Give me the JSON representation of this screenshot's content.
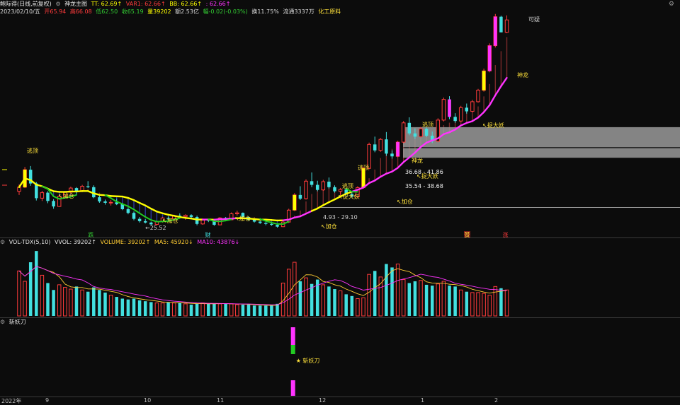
{
  "header": {
    "name": "鲍际得(日线,前复权)",
    "indicator": "神龙主图",
    "tt": "TT: 62.69↑",
    "var1": "VAR1: 62.66↑",
    "bb": "BB: 62.66↑",
    "extra": ": 62.66↑",
    "date": "2023/02/10/五",
    "open": "开65.94",
    "high": "高66.08",
    "low": "低62.50",
    "close": "收65.19",
    "volume": "量39202",
    "amount": "额2.53亿",
    "change": "幅-0.02(-0.03%)",
    "turnover": "换11.75%",
    "float": "流通3337万",
    "sector": "化工原料"
  },
  "vol_header": {
    "name": "VOL-TDX(5,10)",
    "vvol": "VVOL: 39202↑",
    "volume": "VOLUME: 39202↑",
    "ma5": "MA5: 45920↓",
    "ma10": "MA10: 43876↓"
  },
  "third_header": {
    "name": "斩妖刀"
  },
  "annotations": {
    "escape_top_1": "逃顶",
    "escape_top_2": "逃顶",
    "escape_top_3": "逃顶",
    "add_1": "↖加仓",
    "add_2": "↖加仓",
    "add_3": "↖加仓",
    "add_4": "↖加仓",
    "add_5": "↖加仓",
    "low_mark": "←25.52",
    "range_low": "4.93 - 29.10",
    "catch_1": "↖捉大妖",
    "catch_2": "↖捉大妖",
    "catch_3": "↖捉大妖",
    "dragon_1": "神龙",
    "dragon_2": "神龙",
    "band_top_range": "36.68 - 41.86",
    "band_low_range": "35.54 - 38.68",
    "top_mark": "可疑",
    "fall_tag": "跌",
    "fin_tag_1": "财",
    "fin_tag_2": "赞",
    "rise_tag": "涨",
    "blade": "★ 斩妖刀"
  },
  "x_axis": [
    "2022年",
    "9",
    "10",
    "11",
    "12",
    "1",
    "2"
  ],
  "colors": {
    "up": "#ff3b3b",
    "down": "#42e0e0",
    "yellow": "#ffff00",
    "magenta": "#ff33ff",
    "green": "#22cc22",
    "band": "#b0b0b0",
    "text_yellow": "#ffe23b"
  },
  "chart_data": {
    "type": "candlestick",
    "price_candles": [
      [
        27.9,
        29.4,
        27.1,
        28.8
      ],
      [
        28.8,
        33.2,
        28.6,
        32.6
      ],
      [
        32.6,
        33.4,
        29.1,
        29.6
      ],
      [
        29.6,
        29.9,
        25.9,
        26.4
      ],
      [
        26.4,
        28.0,
        25.8,
        27.6
      ],
      [
        27.6,
        27.9,
        25.3,
        25.8
      ],
      [
        25.8,
        26.2,
        24.1,
        24.6
      ],
      [
        24.6,
        27.1,
        24.5,
        26.8
      ],
      [
        26.8,
        28.0,
        26.5,
        27.7
      ],
      [
        27.7,
        28.9,
        27.4,
        28.6
      ],
      [
        28.6,
        28.8,
        27.4,
        27.9
      ],
      [
        27.9,
        29.3,
        27.7,
        29.0
      ],
      [
        29.0,
        30.1,
        28.6,
        28.8
      ],
      [
        28.8,
        29.2,
        26.4,
        26.6
      ],
      [
        26.6,
        27.0,
        25.4,
        25.7
      ],
      [
        25.7,
        26.1,
        25.0,
        25.4
      ],
      [
        25.4,
        26.0,
        24.8,
        25.5
      ],
      [
        25.5,
        26.3,
        24.9,
        25.1
      ],
      [
        25.1,
        25.4,
        23.8,
        24.0
      ],
      [
        24.0,
        24.4,
        22.9,
        23.2
      ],
      [
        23.2,
        23.5,
        21.6,
        21.9
      ],
      [
        21.9,
        22.3,
        21.1,
        21.4
      ],
      [
        21.4,
        21.9,
        20.9,
        21.1
      ],
      [
        21.1,
        21.3,
        20.5,
        20.7
      ],
      [
        20.7,
        21.5,
        20.5,
        21.3
      ],
      [
        21.3,
        22.3,
        21.1,
        22.1
      ],
      [
        22.1,
        22.4,
        21.6,
        21.9
      ],
      [
        21.9,
        22.8,
        21.7,
        22.6
      ],
      [
        22.6,
        23.1,
        22.2,
        22.4
      ],
      [
        22.4,
        22.9,
        21.7,
        22.7
      ],
      [
        22.7,
        22.9,
        22.1,
        22.3
      ],
      [
        22.3,
        22.6,
        20.5,
        20.8
      ],
      [
        20.8,
        21.9,
        20.6,
        21.7
      ],
      [
        21.7,
        21.9,
        21.2,
        21.5
      ],
      [
        21.5,
        21.6,
        20.4,
        20.6
      ],
      [
        20.6,
        22.3,
        20.5,
        22.1
      ],
      [
        22.1,
        22.3,
        21.4,
        21.7
      ],
      [
        21.7,
        23.3,
        21.6,
        23.0
      ],
      [
        23.0,
        23.7,
        22.6,
        23.2
      ],
      [
        23.2,
        23.3,
        22.0,
        22.3
      ],
      [
        22.3,
        22.4,
        21.5,
        21.7
      ],
      [
        21.7,
        21.9,
        21.1,
        21.3
      ],
      [
        21.3,
        21.5,
        20.8,
        21.0
      ],
      [
        21.0,
        21.2,
        20.5,
        20.8
      ],
      [
        20.8,
        21.1,
        20.4,
        20.6
      ],
      [
        20.6,
        20.8,
        20.0,
        20.2
      ],
      [
        20.2,
        21.4,
        20.1,
        21.2
      ],
      [
        21.2,
        24.1,
        21.0,
        23.8
      ],
      [
        23.8,
        27.5,
        23.6,
        27.1
      ],
      [
        27.1,
        29.0,
        26.0,
        26.3
      ],
      [
        26.3,
        30.5,
        26.1,
        30.1
      ],
      [
        30.1,
        32.0,
        28.8,
        29.3
      ],
      [
        29.3,
        30.2,
        27.9,
        28.2
      ],
      [
        28.2,
        30.4,
        28.0,
        30.0
      ],
      [
        30.0,
        30.9,
        28.5,
        28.8
      ],
      [
        28.8,
        29.2,
        27.6,
        27.9
      ],
      [
        27.9,
        28.6,
        27.1,
        28.3
      ],
      [
        28.3,
        28.6,
        27.0,
        27.3
      ],
      [
        27.3,
        27.8,
        26.4,
        26.7
      ],
      [
        26.7,
        29.0,
        26.6,
        28.7
      ],
      [
        28.7,
        33.3,
        28.6,
        32.9
      ],
      [
        32.9,
        38.5,
        32.7,
        38.1
      ],
      [
        38.1,
        39.8,
        36.4,
        36.8
      ],
      [
        36.8,
        39.5,
        36.5,
        39.2
      ],
      [
        39.2,
        40.8,
        35.6,
        36.1
      ],
      [
        36.1,
        36.8,
        35.0,
        35.5
      ],
      [
        35.5,
        38.9,
        35.3,
        38.6
      ],
      [
        38.6,
        43.2,
        38.4,
        42.8
      ],
      [
        42.8,
        44.0,
        40.1,
        40.5
      ],
      [
        40.5,
        41.6,
        39.3,
        39.8
      ],
      [
        39.8,
        41.9,
        39.6,
        41.5
      ],
      [
        41.5,
        41.8,
        39.7,
        40.0
      ],
      [
        40.0,
        40.9,
        38.4,
        38.8
      ],
      [
        38.8,
        43.8,
        38.6,
        43.4
      ],
      [
        43.4,
        48.3,
        43.1,
        47.9
      ],
      [
        47.9,
        48.6,
        43.6,
        44.1
      ],
      [
        44.1,
        44.9,
        42.8,
        43.2
      ],
      [
        43.2,
        46.5,
        43.0,
        46.1
      ],
      [
        46.1,
        47.0,
        44.8,
        45.3
      ],
      [
        45.3,
        47.8,
        45.1,
        47.4
      ],
      [
        47.4,
        50.2,
        47.2,
        49.9
      ],
      [
        49.9,
        54.6,
        49.6,
        54.1
      ],
      [
        54.1,
        60.1,
        53.8,
        59.6
      ],
      [
        59.6,
        66.5,
        59.2,
        65.9
      ],
      [
        65.9,
        66.1,
        62.5,
        62.5
      ],
      [
        62.5,
        66.2,
        62.3,
        65.2
      ]
    ],
    "volume": [
      52,
      40,
      62,
      75,
      47,
      38,
      30,
      36,
      33,
      31,
      34,
      30,
      28,
      33,
      30,
      27,
      24,
      22,
      20,
      19,
      20,
      18,
      17,
      16,
      15,
      15,
      16,
      15,
      15,
      14,
      13,
      14,
      15,
      14,
      14,
      14,
      14,
      14,
      13,
      13,
      13,
      12,
      12,
      12,
      12,
      14,
      38,
      54,
      62,
      40,
      44,
      37,
      42,
      36,
      34,
      31,
      29,
      25,
      23,
      20,
      21,
      48,
      52,
      45,
      60,
      56,
      60,
      42,
      38,
      40,
      41,
      36,
      35,
      37,
      40,
      35,
      34,
      30,
      28,
      27,
      27,
      26,
      24,
      34,
      32,
      30
    ],
    "blade_bar": {
      "index": 47,
      "segments": [
        "magenta",
        "green",
        "magenta"
      ]
    }
  }
}
